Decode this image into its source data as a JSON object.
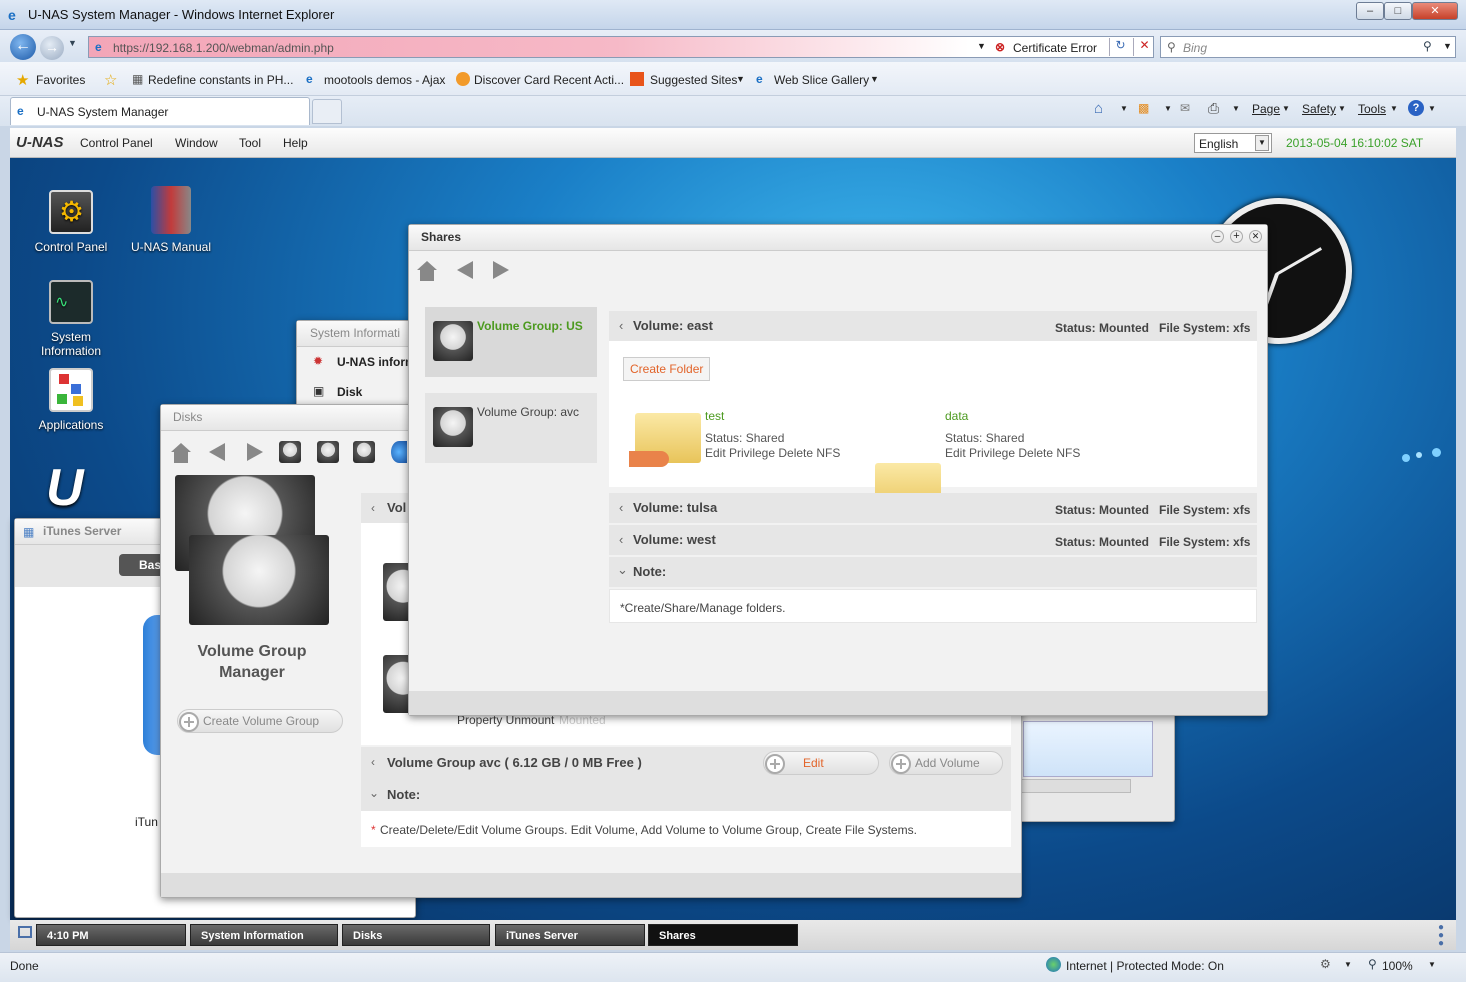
{
  "browser": {
    "title": "U-NAS System Manager - Windows Internet Explorer",
    "url": "https://192.168.1.200/webman/admin.php",
    "cert_error": "Certificate Error",
    "search_placeholder": "Bing",
    "status_left": "Done",
    "status_zone": "Internet | Protected Mode: On",
    "zoom": "100%"
  },
  "favorites": {
    "label": "Favorites",
    "items": [
      "Redefine constants in PH...",
      "mootools demos - Ajax",
      "Discover Card Recent Acti...",
      "Suggested Sites",
      "Web Slice Gallery"
    ]
  },
  "tab": {
    "label": "U-NAS System Manager"
  },
  "commandbar": {
    "page": "Page",
    "safety": "Safety",
    "tools": "Tools"
  },
  "app": {
    "logo": "U-NAS",
    "menu": [
      "Control Panel",
      "Window",
      "Tool",
      "Help"
    ],
    "language": "English",
    "datetime": "2013-05-04 16:10:02 SAT"
  },
  "desktop_icons": [
    {
      "label": "Control Panel"
    },
    {
      "label": "U-NAS Manual"
    },
    {
      "label": "System Information"
    },
    {
      "label": "Applications"
    }
  ],
  "sysinfo_window": {
    "title": "System Informati",
    "items": [
      "U-NAS inform",
      "Disk"
    ]
  },
  "itunes_window": {
    "title": "iTunes Server",
    "tab": "Bas",
    "label": "iTun"
  },
  "disks_window": {
    "title": "Disks",
    "side_title": "Volume Group Manager",
    "create_btn": "Create Volume Group",
    "row_partial": "Vol",
    "property_text": "Property Unmount",
    "property_faded": "Mounted",
    "vg_row": "Volume Group avc ( 6.12 GB / 0 MB Free )",
    "edit_btn": "Edit",
    "add_volume_btn": "Add Volume",
    "note_label": "Note:",
    "note_text": "Create/Delete/Edit Volume Groups. Edit Volume, Add Volume to Volume Group, Create File Systems."
  },
  "shares_window": {
    "title": "Shares",
    "groups": [
      {
        "label": "Volume Group: US",
        "active": true
      },
      {
        "label": "Volume Group: avc",
        "active": false
      }
    ],
    "volumes": [
      {
        "name": "Volume: east",
        "status": "Status: Mounted",
        "fs": "File System: xfs"
      },
      {
        "name": "Volume: tulsa",
        "status": "Status: Mounted",
        "fs": "File System: xfs"
      },
      {
        "name": "Volume: west",
        "status": "Status: Mounted",
        "fs": "File System: xfs"
      }
    ],
    "create_folder": "Create Folder",
    "folders": [
      {
        "name": "test",
        "status": "Status: Shared",
        "actions": "Edit Privilege Delete NFS"
      },
      {
        "name": "data",
        "status": "Status: Shared",
        "actions": "Edit Privilege Delete NFS"
      }
    ],
    "note_label": "Note:",
    "note_text": "*Create/Share/Manage folders."
  },
  "taskbar": {
    "time": "4:10 PM",
    "items": [
      "System Information",
      "Disks",
      "iTunes Server",
      "Shares"
    ]
  },
  "colors": {
    "accent_green": "#4c9a1f",
    "create_folder_orange": "#e2642a",
    "time_green": "#3aa12a"
  }
}
